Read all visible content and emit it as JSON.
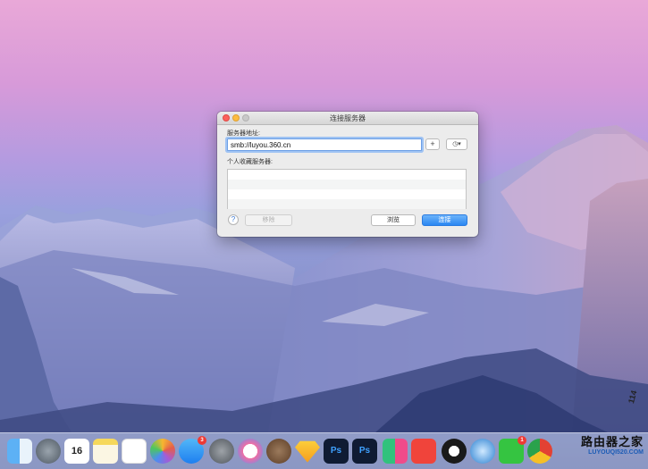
{
  "dialog": {
    "title": "连接服务器",
    "server_address_label": "服务器地址:",
    "server_address_value": "smb://luyou.360.cn",
    "add_button": "+",
    "recent_button": "◷▾",
    "favorites_label": "个人收藏服务器:",
    "help_button": "?",
    "remove_button": "移除",
    "browse_button": "浏览",
    "connect_button": "连接"
  },
  "dock": {
    "items": [
      {
        "name": "finder",
        "label": ""
      },
      {
        "name": "launchpad",
        "label": ""
      },
      {
        "name": "calendar",
        "label": "16"
      },
      {
        "name": "notes",
        "label": ""
      },
      {
        "name": "reminders",
        "label": ""
      },
      {
        "name": "photos",
        "label": ""
      },
      {
        "name": "app-store",
        "label": "",
        "badge": "3"
      },
      {
        "name": "system-preferences",
        "label": ""
      },
      {
        "name": "itunes",
        "label": ""
      },
      {
        "name": "walnut",
        "label": ""
      },
      {
        "name": "sketch",
        "label": ""
      },
      {
        "name": "photoshop-1",
        "label": "Ps"
      },
      {
        "name": "photoshop-2",
        "label": "Ps"
      },
      {
        "name": "app-green",
        "label": ""
      },
      {
        "name": "app-red",
        "label": ""
      },
      {
        "name": "qq",
        "label": ""
      },
      {
        "name": "safari-like",
        "label": ""
      },
      {
        "name": "wechat",
        "label": "",
        "badge": "1"
      },
      {
        "name": "chrome",
        "label": ""
      }
    ]
  },
  "watermark": {
    "title": "路由器之家",
    "url": "LUYOUQI520.COM",
    "side": "114"
  },
  "colors": {
    "accent": "#2a87f2",
    "sky_top": "#e9a8d8",
    "mountain": "#6f7fba"
  }
}
